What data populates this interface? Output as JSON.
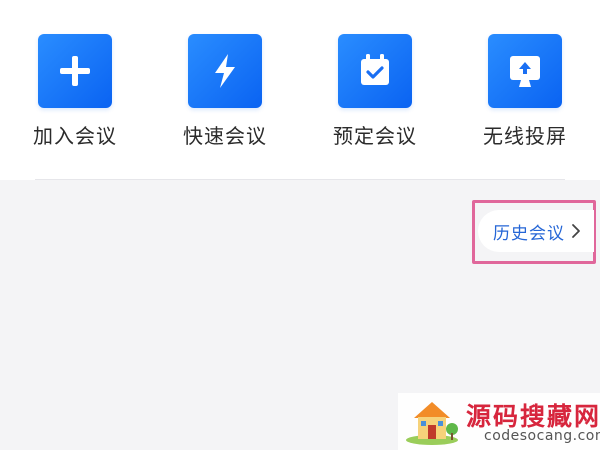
{
  "actions": [
    {
      "label": "加入会议",
      "icon": "plus-icon"
    },
    {
      "label": "快速会议",
      "icon": "lightning-icon"
    },
    {
      "label": "预定会议",
      "icon": "calendar-check-icon"
    },
    {
      "label": "无线投屏",
      "icon": "screen-share-icon"
    }
  ],
  "history": {
    "label": "历史会议",
    "icon": "chevron-right-icon"
  },
  "watermark": {
    "title": "源码搜藏网",
    "url": "codesocang.com"
  },
  "colors": {
    "accent_blue": "#1a73f5",
    "link_blue": "#2566d6",
    "highlight_pink": "#e0679b",
    "page_bg": "#f4f4f6"
  }
}
